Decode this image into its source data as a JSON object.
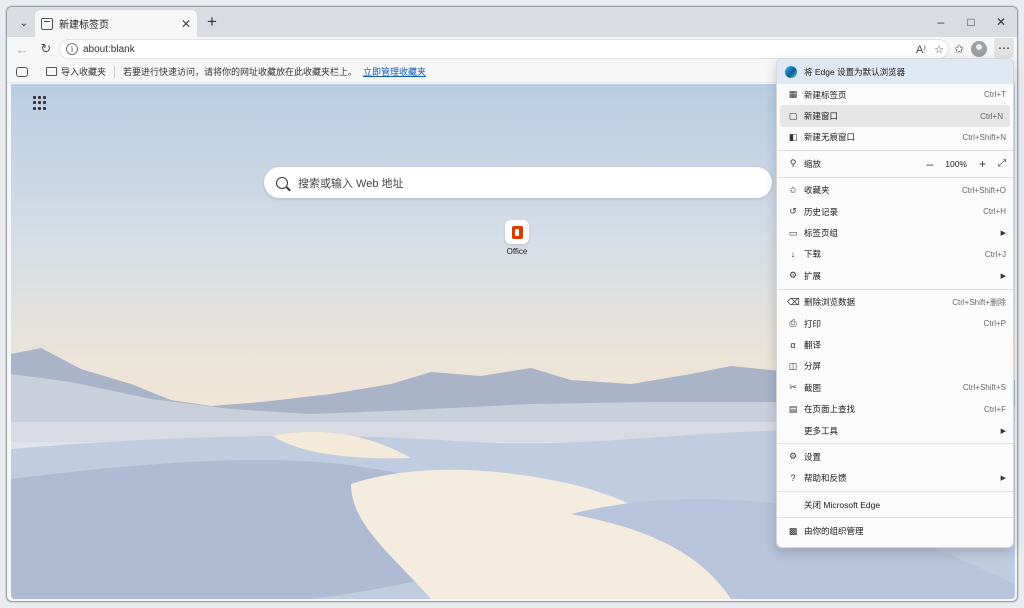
{
  "tab": {
    "title": "新建标签页"
  },
  "address": {
    "url": "about:blank",
    "read_aloud": "A⁾"
  },
  "favbar": {
    "import_label": "导入收藏夹",
    "hint": "若要进行快速访问，请将你的网址收藏放在此收藏夹栏上。",
    "manage_link": "立即管理收藏夹"
  },
  "newtab": {
    "search_placeholder": "搜索或输入 Web 地址",
    "tiles": [
      {
        "label": "Office"
      }
    ]
  },
  "menu": {
    "banner": "将 Edge 设置为默认浏览器",
    "group1": [
      {
        "label": "新建标签页",
        "shortcut": "Ctrl+T",
        "icon": "tab-icon"
      },
      {
        "label": "新建窗口",
        "shortcut": "Ctrl+N",
        "icon": "window-icon"
      },
      {
        "label": "新建无痕窗口",
        "shortcut": "Ctrl+Shift+N",
        "icon": "inprivate-icon"
      }
    ],
    "zoom": {
      "label": "缩放",
      "value": "100%"
    },
    "group2": [
      {
        "label": "收藏夹",
        "shortcut": "Ctrl+Shift+O",
        "icon": "favorites-icon"
      },
      {
        "label": "历史记录",
        "shortcut": "Ctrl+H",
        "icon": "history-icon"
      },
      {
        "label": "标签页组",
        "shortcut": "",
        "icon": "tab-groups-icon"
      },
      {
        "label": "下载",
        "shortcut": "Ctrl+J",
        "icon": "download-icon"
      },
      {
        "label": "扩展",
        "shortcut": "",
        "icon": "extensions-icon"
      }
    ],
    "group3": [
      {
        "label": "删除浏览数据",
        "shortcut": "Ctrl+Shift+删除",
        "icon": "trash-icon"
      },
      {
        "label": "打印",
        "shortcut": "Ctrl+P",
        "icon": "print-icon"
      },
      {
        "label": "翻译",
        "shortcut": "",
        "icon": "translate-icon"
      },
      {
        "label": "分屏",
        "shortcut": "",
        "icon": "split-screen-icon"
      },
      {
        "label": "截图",
        "shortcut": "Ctrl+Shift+S",
        "icon": "screenshot-icon"
      },
      {
        "label": "在页面上查找",
        "shortcut": "Ctrl+F",
        "icon": "find-icon"
      },
      {
        "label": "更多工具",
        "shortcut": "",
        "icon": ""
      }
    ],
    "group4": [
      {
        "label": "设置",
        "icon": "settings-icon"
      },
      {
        "label": "帮助和反馈",
        "icon": "help-icon"
      }
    ],
    "close": "关闭 Microsoft Edge",
    "managed": "由你的组织管理"
  }
}
